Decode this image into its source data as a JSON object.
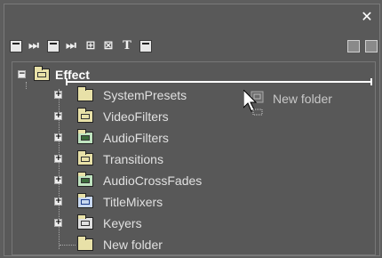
{
  "window": {
    "close_symbol": "✕"
  },
  "toolbar": {
    "icons": [
      "list-view-icon",
      "skip-icon",
      "list-view-icon",
      "skip-icon",
      "grid-icon",
      "grid-arrow-icon",
      "text-icon",
      "window-icon"
    ],
    "text_glyph": "T",
    "right_icons": [
      "save-icon",
      "lock-icon"
    ]
  },
  "tree": {
    "root": {
      "label": "Effect",
      "expanded": true
    },
    "items": [
      {
        "label": "SystemPresets",
        "icon": "folder-presets-icon"
      },
      {
        "label": "VideoFilters",
        "icon": "folder-video-icon"
      },
      {
        "label": "AudioFilters",
        "icon": "folder-audio-icon"
      },
      {
        "label": "Transitions",
        "icon": "folder-transitions-icon"
      },
      {
        "label": "AudioCrossFades",
        "icon": "folder-crossfade-icon"
      },
      {
        "label": "TitleMixers",
        "icon": "folder-title-icon"
      },
      {
        "label": "Keyers",
        "icon": "folder-keyers-icon"
      },
      {
        "label": "New folder",
        "icon": "folder-icon"
      }
    ],
    "drag_ghost_label": "New folder"
  },
  "colors": {
    "background": "#5e5e5e",
    "text": "#e0e0e0",
    "folder": "#e8e1a8"
  }
}
